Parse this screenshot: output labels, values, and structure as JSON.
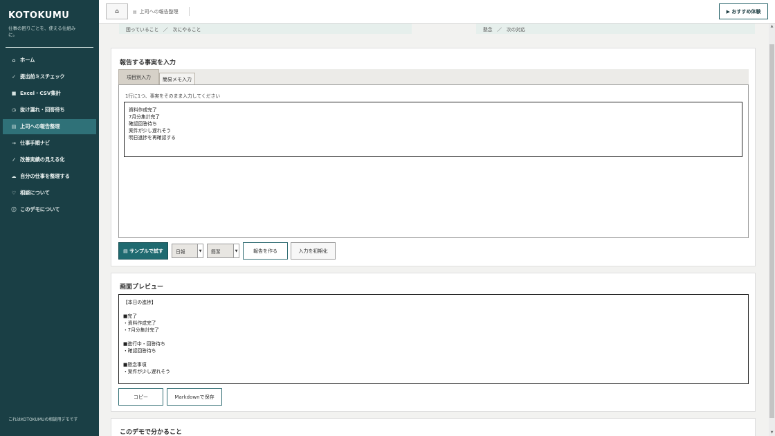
{
  "sidebar": {
    "brand": "KOTOKUMU",
    "tagline": "仕事の困りごとを、使える仕組みに。",
    "items": [
      {
        "icon": "⌂",
        "label": "ホーム"
      },
      {
        "icon": "✓",
        "label": "提出前ミスチェック"
      },
      {
        "icon": "■",
        "label": "Excel・CSV集計"
      },
      {
        "icon": "◷",
        "label": "抜け漏れ・回答待ち"
      },
      {
        "icon": "▤",
        "label": "上司への報告整理"
      },
      {
        "icon": "→",
        "label": "仕事手順ナビ"
      },
      {
        "icon": "⁄",
        "label": "改善実績の見える化"
      },
      {
        "icon": "☁",
        "label": "自分の仕事を整理する"
      },
      {
        "icon": "♡",
        "label": "相談について"
      },
      {
        "icon": "ⓘ",
        "label": "このデモについて"
      }
    ],
    "footer": "これはKOTOKUMUの相談用デモです"
  },
  "topbar": {
    "home_icon": "⌂",
    "breadcrumb_icon": "▤",
    "breadcrumb": "上司への報告整理",
    "trial_label": "▶ おすすめ体験"
  },
  "strips": {
    "left": "困っていること　／　次にやること",
    "right": "懸念　／　次の対応"
  },
  "input_card": {
    "title": "報告する事実を入力",
    "tabs": [
      "項目別入力",
      "簡易メモ入力"
    ],
    "instruction": "1行に1つ、事実をそのまま入力してください",
    "facts": [
      "資料作成完了",
      "7月分集計完了",
      "確認回答待ち",
      "案件が少し遅れそう",
      "明日進捗を再確認する"
    ],
    "sample_button": "▤ サンプルで試す",
    "select_period": "日報",
    "select_style": "簡潔",
    "create_button": "報告を作る",
    "reset_button": "入力を初期化"
  },
  "preview_card": {
    "title": "画面プレビュー",
    "lines": [
      "【本日の進捗】",
      "",
      "■完了",
      "・資料作成完了",
      "・7月分集計完了",
      "",
      "■進行中・回答待ち",
      "・確認回答待ち",
      "",
      "■懸念事項",
      "・案件が少し遅れそう"
    ],
    "copy_button": "コピー",
    "save_button": "Markdownで保存"
  },
  "learn_card": {
    "title": "このデモで分かること"
  },
  "colors": {
    "sidebar_bg": "#1a3f45",
    "active_nav": "#2f7178",
    "primary_button": "#1f6a70"
  }
}
